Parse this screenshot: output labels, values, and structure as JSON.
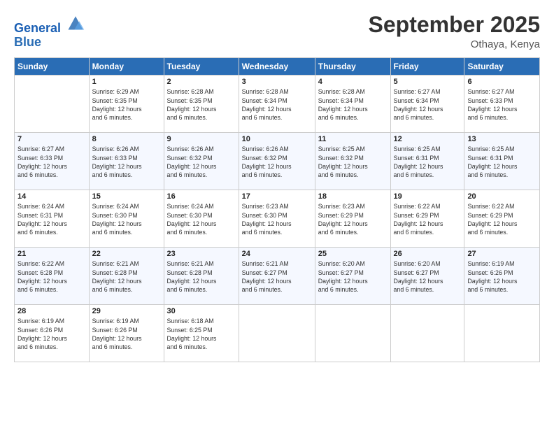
{
  "logo": {
    "line1": "General",
    "line2": "Blue"
  },
  "title": "September 2025",
  "location": "Othaya, Kenya",
  "header_days": [
    "Sunday",
    "Monday",
    "Tuesday",
    "Wednesday",
    "Thursday",
    "Friday",
    "Saturday"
  ],
  "weeks": [
    [
      {
        "day": "",
        "info": ""
      },
      {
        "day": "1",
        "info": "Sunrise: 6:29 AM\nSunset: 6:35 PM\nDaylight: 12 hours\nand 6 minutes."
      },
      {
        "day": "2",
        "info": "Sunrise: 6:28 AM\nSunset: 6:35 PM\nDaylight: 12 hours\nand 6 minutes."
      },
      {
        "day": "3",
        "info": "Sunrise: 6:28 AM\nSunset: 6:34 PM\nDaylight: 12 hours\nand 6 minutes."
      },
      {
        "day": "4",
        "info": "Sunrise: 6:28 AM\nSunset: 6:34 PM\nDaylight: 12 hours\nand 6 minutes."
      },
      {
        "day": "5",
        "info": "Sunrise: 6:27 AM\nSunset: 6:34 PM\nDaylight: 12 hours\nand 6 minutes."
      },
      {
        "day": "6",
        "info": "Sunrise: 6:27 AM\nSunset: 6:33 PM\nDaylight: 12 hours\nand 6 minutes."
      }
    ],
    [
      {
        "day": "7",
        "info": "Sunrise: 6:27 AM\nSunset: 6:33 PM\nDaylight: 12 hours\nand 6 minutes."
      },
      {
        "day": "8",
        "info": "Sunrise: 6:26 AM\nSunset: 6:33 PM\nDaylight: 12 hours\nand 6 minutes."
      },
      {
        "day": "9",
        "info": "Sunrise: 6:26 AM\nSunset: 6:32 PM\nDaylight: 12 hours\nand 6 minutes."
      },
      {
        "day": "10",
        "info": "Sunrise: 6:26 AM\nSunset: 6:32 PM\nDaylight: 12 hours\nand 6 minutes."
      },
      {
        "day": "11",
        "info": "Sunrise: 6:25 AM\nSunset: 6:32 PM\nDaylight: 12 hours\nand 6 minutes."
      },
      {
        "day": "12",
        "info": "Sunrise: 6:25 AM\nSunset: 6:31 PM\nDaylight: 12 hours\nand 6 minutes."
      },
      {
        "day": "13",
        "info": "Sunrise: 6:25 AM\nSunset: 6:31 PM\nDaylight: 12 hours\nand 6 minutes."
      }
    ],
    [
      {
        "day": "14",
        "info": "Sunrise: 6:24 AM\nSunset: 6:31 PM\nDaylight: 12 hours\nand 6 minutes."
      },
      {
        "day": "15",
        "info": "Sunrise: 6:24 AM\nSunset: 6:30 PM\nDaylight: 12 hours\nand 6 minutes."
      },
      {
        "day": "16",
        "info": "Sunrise: 6:24 AM\nSunset: 6:30 PM\nDaylight: 12 hours\nand 6 minutes."
      },
      {
        "day": "17",
        "info": "Sunrise: 6:23 AM\nSunset: 6:30 PM\nDaylight: 12 hours\nand 6 minutes."
      },
      {
        "day": "18",
        "info": "Sunrise: 6:23 AM\nSunset: 6:29 PM\nDaylight: 12 hours\nand 6 minutes."
      },
      {
        "day": "19",
        "info": "Sunrise: 6:22 AM\nSunset: 6:29 PM\nDaylight: 12 hours\nand 6 minutes."
      },
      {
        "day": "20",
        "info": "Sunrise: 6:22 AM\nSunset: 6:29 PM\nDaylight: 12 hours\nand 6 minutes."
      }
    ],
    [
      {
        "day": "21",
        "info": "Sunrise: 6:22 AM\nSunset: 6:28 PM\nDaylight: 12 hours\nand 6 minutes."
      },
      {
        "day": "22",
        "info": "Sunrise: 6:21 AM\nSunset: 6:28 PM\nDaylight: 12 hours\nand 6 minutes."
      },
      {
        "day": "23",
        "info": "Sunrise: 6:21 AM\nSunset: 6:28 PM\nDaylight: 12 hours\nand 6 minutes."
      },
      {
        "day": "24",
        "info": "Sunrise: 6:21 AM\nSunset: 6:27 PM\nDaylight: 12 hours\nand 6 minutes."
      },
      {
        "day": "25",
        "info": "Sunrise: 6:20 AM\nSunset: 6:27 PM\nDaylight: 12 hours\nand 6 minutes."
      },
      {
        "day": "26",
        "info": "Sunrise: 6:20 AM\nSunset: 6:27 PM\nDaylight: 12 hours\nand 6 minutes."
      },
      {
        "day": "27",
        "info": "Sunrise: 6:19 AM\nSunset: 6:26 PM\nDaylight: 12 hours\nand 6 minutes."
      }
    ],
    [
      {
        "day": "28",
        "info": "Sunrise: 6:19 AM\nSunset: 6:26 PM\nDaylight: 12 hours\nand 6 minutes."
      },
      {
        "day": "29",
        "info": "Sunrise: 6:19 AM\nSunset: 6:26 PM\nDaylight: 12 hours\nand 6 minutes."
      },
      {
        "day": "30",
        "info": "Sunrise: 6:18 AM\nSunset: 6:25 PM\nDaylight: 12 hours\nand 6 minutes."
      },
      {
        "day": "",
        "info": ""
      },
      {
        "day": "",
        "info": ""
      },
      {
        "day": "",
        "info": ""
      },
      {
        "day": "",
        "info": ""
      }
    ]
  ]
}
